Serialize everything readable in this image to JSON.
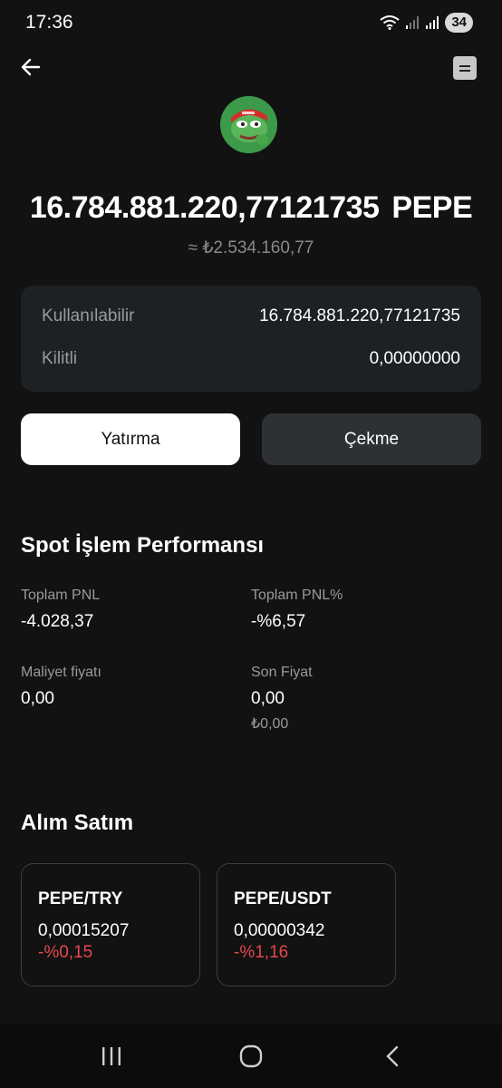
{
  "status": {
    "time": "17:36",
    "battery": "34"
  },
  "asset": {
    "balance": "16.784.881.220,77121735",
    "symbol": "PEPE",
    "fiat_value": "≈ ₺2.534.160,77"
  },
  "details": {
    "available_label": "Kullanılabilir",
    "available_value": "16.784.881.220,77121735",
    "locked_label": "Kilitli",
    "locked_value": "0,00000000"
  },
  "actions": {
    "deposit": "Yatırma",
    "withdraw": "Çekme"
  },
  "performance": {
    "title": "Spot İşlem Performansı",
    "total_pnl_label": "Toplam PNL",
    "total_pnl_value": "-4.028,37",
    "total_pnl_pct_label": "Toplam PNL%",
    "total_pnl_pct_value": "-%6,57",
    "cost_label": "Maliyet fiyatı",
    "cost_value": "0,00",
    "last_price_label": "Son Fiyat",
    "last_price_value": "0,00",
    "last_price_fiat": "₺0,00"
  },
  "trading": {
    "title": "Alım Satım",
    "pairs": [
      {
        "name": "PEPE/TRY",
        "price": "0,00015207",
        "change": "-%0,15"
      },
      {
        "name": "PEPE/USDT",
        "price": "0,00000342",
        "change": "-%1,16"
      }
    ]
  },
  "colors": {
    "negative": "#e5484d",
    "background": "#121212",
    "card": "#1e2124"
  },
  "icons": {
    "back": "arrow-left-icon",
    "document": "document-icon",
    "coin": "pepe-logo"
  }
}
